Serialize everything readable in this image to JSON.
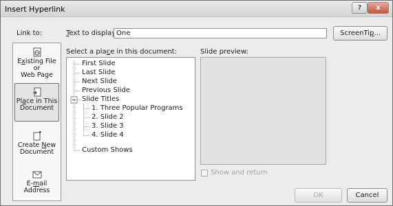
{
  "window": {
    "title": "Insert Hyperlink",
    "help_glyph": "?",
    "close_glyph": "x"
  },
  "link_to": {
    "label": "Link to:",
    "items": [
      {
        "label": "Existing File or Web Page",
        "icon": "globe-page-icon"
      },
      {
        "label": "Place in This Document",
        "icon": "document-arrow-icon"
      },
      {
        "label": "Create New Document",
        "icon": "new-document-icon"
      },
      {
        "label": "E-mail Address",
        "icon": "envelope-icon"
      }
    ],
    "selected_index": 1
  },
  "text_to_display": {
    "label": "Text to display:",
    "value": "One"
  },
  "screentip_button": "ScreenTip...",
  "place_list": {
    "label": "Select a place in this document:",
    "nodes": [
      {
        "text": "First Slide"
      },
      {
        "text": "Last Slide"
      },
      {
        "text": "Next Slide"
      },
      {
        "text": "Previous Slide"
      },
      {
        "text": "Slide Titles",
        "toggle": "⊟"
      },
      {
        "text": "1. Three Popular Programs"
      },
      {
        "text": "2. Slide 2"
      },
      {
        "text": "3. Slide 3"
      },
      {
        "text": "4. Slide 4"
      },
      {
        "text": "Custom Shows"
      }
    ]
  },
  "slide_preview": {
    "label": "Slide preview:"
  },
  "show_and_return": {
    "label": "Show and return",
    "checked": false,
    "enabled": false
  },
  "buttons": {
    "ok": "OK",
    "cancel": "Cancel"
  },
  "colors": {
    "title_bar": "#d4d4d4",
    "close_button": "#c4553f",
    "dialog_bg": "#ececec",
    "preview_bg": "#e2e2e2"
  }
}
